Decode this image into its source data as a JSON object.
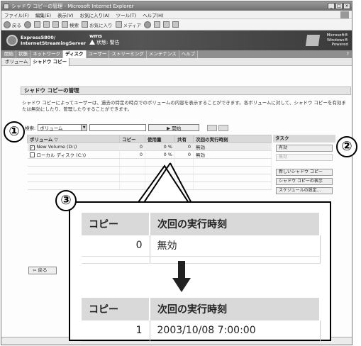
{
  "window": {
    "title": "シャドウ コピーの管理 - Microsoft Internet Explorer",
    "controls": [
      "_",
      "□",
      "×"
    ]
  },
  "menubar": [
    "ファイル(F)",
    "編集(E)",
    "表示(V)",
    "お気に入り(A)",
    "ツール(T)",
    "ヘルプ(H)"
  ],
  "toolbar": {
    "back": "戻る",
    "search": "検索",
    "favorites": "お気に入り",
    "media": "メディア"
  },
  "banner": {
    "product_line1": "Express5800/",
    "product_line2": "InternetStreamingServer",
    "server_name": "wms",
    "status": "状態: 警告",
    "windows_line1": "Microsoft®",
    "windows_line2": "Windows®",
    "windows_line3": "Powered"
  },
  "nav_tabs": [
    "開始",
    "状態",
    "ネットワーク",
    "ディスク",
    "ユーザー",
    "ストリーミング",
    "メンテナンス",
    "ヘルプ"
  ],
  "nav_active_index": 3,
  "nav_help": "?",
  "sub_tabs": [
    "ボリューム",
    "シャドウ コピー"
  ],
  "sub_active_index": 1,
  "page_heading": "シャドウ コピーの管理",
  "description": "シャドウ コピーによってユーザーは、過去の特定の時点でのボリュームの内容を表示することができます。各ボリュームに対して、シャドウ コピーを有効または無効にしたり、管理したりすることができます。",
  "search": {
    "label": "検索:",
    "selected": "ボリューム",
    "value": "",
    "start_button": "▶ 開始"
  },
  "table": {
    "columns": [
      "ボリューム ▽",
      "コピー",
      "使用量",
      "共有",
      "次回の実行時刻"
    ],
    "rows": [
      {
        "checked": true,
        "volume": "New Volume (D:\\)",
        "copies": "0",
        "usage": "0 %",
        "shares": "0",
        "next_run": "無効"
      },
      {
        "checked": false,
        "volume": "ローカル ディスク (C:\\)",
        "copies": "0",
        "usage": "0 %",
        "shares": "0",
        "next_run": "無効"
      }
    ]
  },
  "tasks": {
    "header": "タスク",
    "items": [
      {
        "label": "有効",
        "enabled": true
      },
      {
        "label": "無効",
        "enabled": false
      },
      {
        "label": "新しいシャドウ コピー",
        "enabled": true
      },
      {
        "label": "シャドウ コピーの表示",
        "enabled": true
      },
      {
        "label": "スケジュールの設定...",
        "enabled": true
      }
    ]
  },
  "back_button": "⇦ 戻る",
  "callouts": [
    "①",
    "②",
    "③"
  ],
  "zoom": {
    "col_copy": "コピー",
    "col_next": "次回の実行時刻",
    "before": {
      "copies": "0",
      "next_run": "無効"
    },
    "after": {
      "copies": "1",
      "next_run": "2003/10/08 7:00:00"
    }
  }
}
